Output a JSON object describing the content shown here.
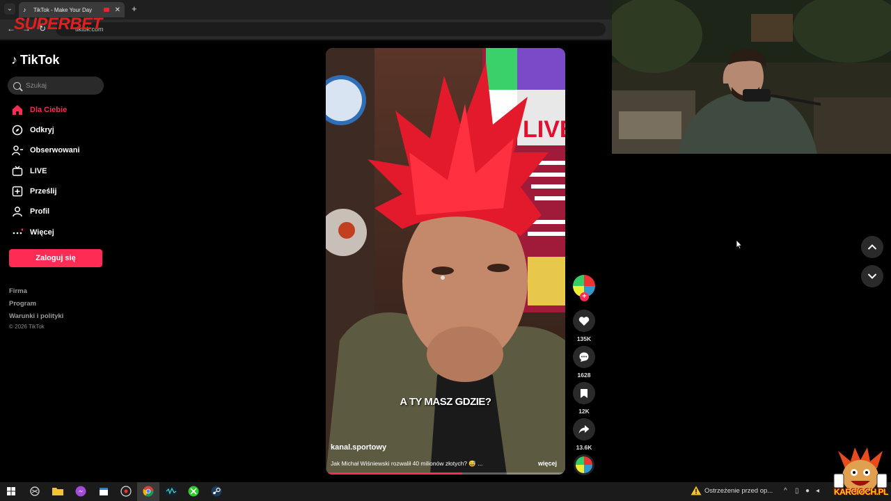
{
  "browser": {
    "tab_title": "TikTok - Make Your Day",
    "tab_close": "✕",
    "new_tab": "+",
    "url": "tiktok.com",
    "overlay_brand": "SUPERBET"
  },
  "tiktok": {
    "logo": "TikTok",
    "search": {
      "placeholder": "Szukaj"
    },
    "nav": [
      {
        "label": "Dla Ciebie",
        "icon": "home-icon",
        "active": true
      },
      {
        "label": "Odkryj",
        "icon": "compass-icon"
      },
      {
        "label": "Obserwowani",
        "icon": "following-icon"
      },
      {
        "label": "LIVE",
        "icon": "live-icon"
      },
      {
        "label": "Prześlij",
        "icon": "upload-icon"
      },
      {
        "label": "Profil",
        "icon": "profile-icon"
      },
      {
        "label": "Więcej",
        "icon": "more-icon"
      }
    ],
    "login_label": "Zaloguj się",
    "footer": [
      "Firma",
      "Program",
      "Warunki i polityki"
    ],
    "copyright": "© 2026 TikTok"
  },
  "video": {
    "caption": "A TY MASZ GDZIE?",
    "overlay_live": "LIVE",
    "author": "kanal.sportowy",
    "description": "Jak Michał Wiśniewski rozwalił 40 milionów złotych? 😅 ...",
    "more_label": "więcej",
    "progress": 0.57,
    "follow_plus": "+",
    "likes": "135K",
    "comments": "1628",
    "saves": "12K",
    "shares": "13.6K"
  },
  "taskbar": {
    "warning_text": "Ostrzeżenie przed op...",
    "watermark": "KARCIOCH.PL"
  },
  "colors": {
    "accent": "#fe2c55",
    "background": "#000000"
  }
}
